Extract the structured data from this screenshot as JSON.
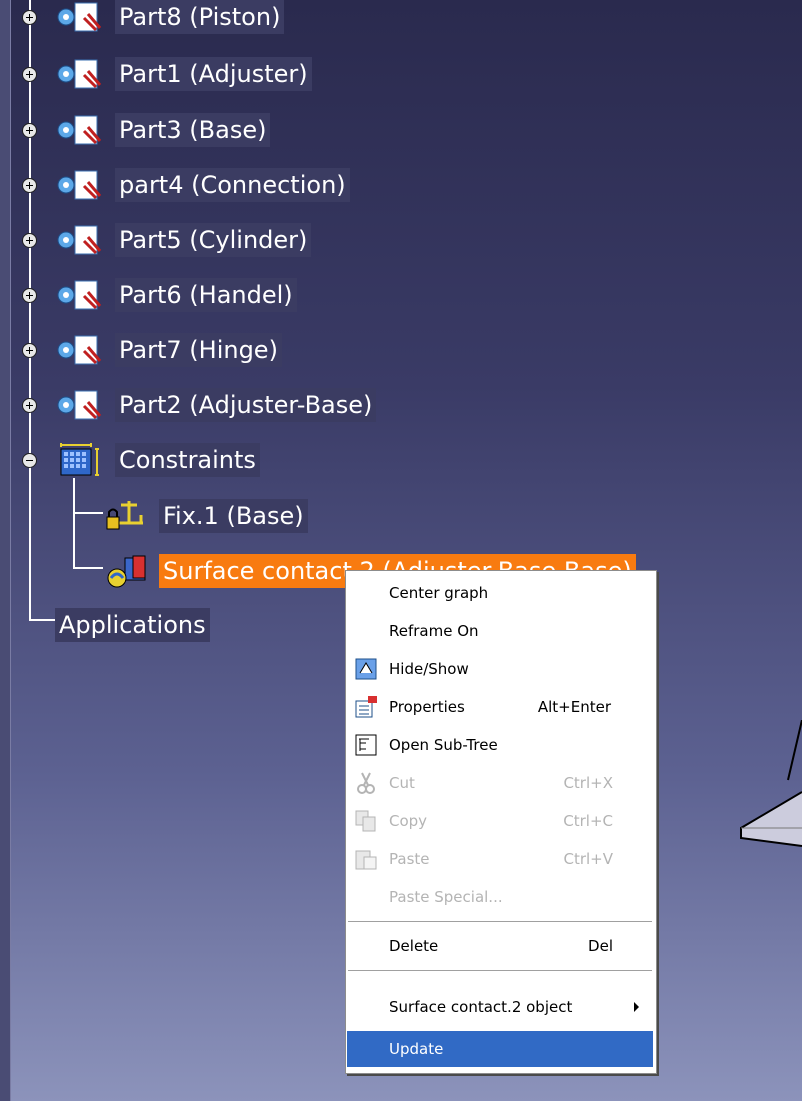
{
  "tree": {
    "parts": [
      {
        "label": "Part8 (Piston)"
      },
      {
        "label": "Part1 (Adjuster)"
      },
      {
        "label": "Part3 (Base)"
      },
      {
        "label": "part4 (Connection)"
      },
      {
        "label": "Part5 (Cylinder)"
      },
      {
        "label": "Part6 (Handel)"
      },
      {
        "label": "Part7 (Hinge)"
      },
      {
        "label": "Part2 (Adjuster-Base)"
      }
    ],
    "constraints": {
      "label": "Constraints",
      "children": [
        {
          "label": "Fix.1 (Base)",
          "icon": "fix-constraint-icon"
        },
        {
          "label": "Surface contact.2 (Adjuster-Base-Base)",
          "icon": "surface-contact-icon",
          "selected": true
        }
      ]
    },
    "applications": {
      "label": "Applications"
    }
  },
  "context_menu": {
    "items": [
      {
        "label": "Center graph",
        "icon": "",
        "enabled": true
      },
      {
        "label": "Reframe On",
        "icon": "",
        "enabled": true
      },
      {
        "label": "Hide/Show",
        "icon": "hide-show-icon",
        "enabled": true
      },
      {
        "label": "Properties",
        "shortcut": "Alt+Enter",
        "icon": "properties-icon",
        "enabled": true
      },
      {
        "label": "Open Sub-Tree",
        "icon": "sub-tree-icon",
        "enabled": true
      },
      {
        "label": "Cut",
        "shortcut": "Ctrl+X",
        "icon": "scissors-icon",
        "enabled": false
      },
      {
        "label": "Copy",
        "shortcut": "Ctrl+C",
        "icon": "copy-icon",
        "enabled": false
      },
      {
        "label": "Paste",
        "shortcut": "Ctrl+V",
        "icon": "paste-icon",
        "enabled": false
      },
      {
        "label": "Paste Special...",
        "icon": "",
        "enabled": false
      },
      {
        "label": "Delete",
        "shortcut": "Del",
        "icon": "",
        "enabled": true
      },
      {
        "label": "Surface contact.2 object",
        "icon": "",
        "enabled": true,
        "submenu": true
      },
      {
        "label": "Update",
        "icon": "",
        "enabled": true,
        "highlighted": true
      }
    ]
  },
  "colors": {
    "selection": "#f87b10",
    "menu_highlight": "#316ac5",
    "background_top": "#2a2a4e",
    "background_bottom": "#8c93bb"
  }
}
